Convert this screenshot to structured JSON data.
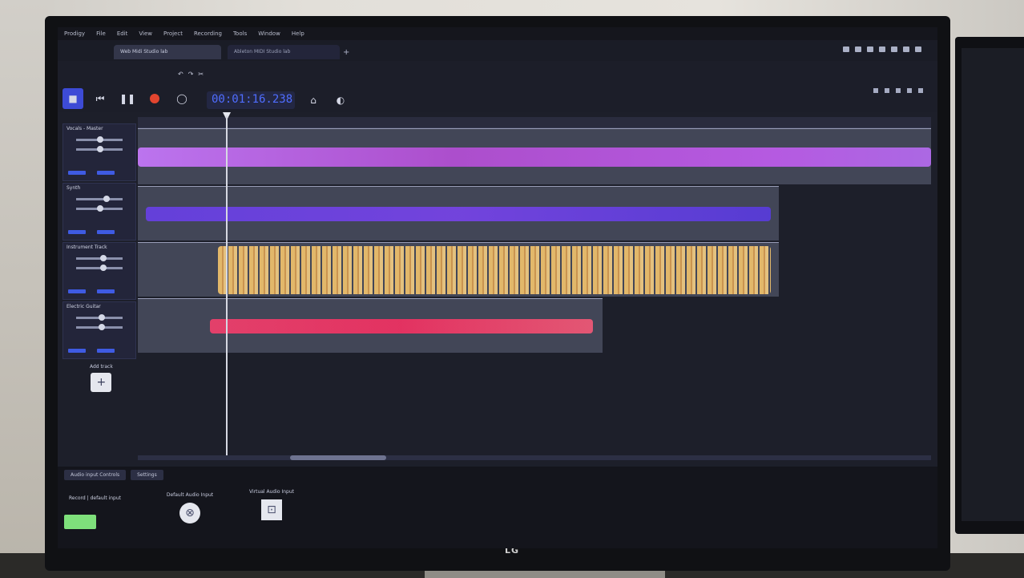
{
  "app": {
    "menu": [
      "Prodigy",
      "File",
      "Edit",
      "View",
      "Project",
      "Recording",
      "Tools",
      "Window",
      "Help"
    ]
  },
  "tabs": [
    {
      "label": "Web Midi Studio lab"
    },
    {
      "label": "Ableton MIDI Studio lab"
    }
  ],
  "transport": {
    "time": "00:01:16.238",
    "buttons": [
      "stop-icon",
      "skip-back-icon",
      "pause-icon",
      "record-icon",
      "loop-icon"
    ],
    "tools": [
      "metronome-icon",
      "settings-icon"
    ],
    "accent": "#3d4bd6",
    "record_color": "#e2452f"
  },
  "tracks": [
    {
      "name": "Vocals - Master",
      "color": "#b86cf2"
    },
    {
      "name": "Synth",
      "color": "#6f4cf0"
    },
    {
      "name": "Instrument Track",
      "color": "#f3c46a"
    },
    {
      "name": "Electric Guitar",
      "color": "#ff3f6e"
    }
  ],
  "add_track": {
    "label": "Add track"
  },
  "bottom": {
    "tabs": [
      "Audio input Controls",
      "Settings"
    ],
    "record_device": "Record | default input",
    "devices": [
      {
        "label": "Default Audio Input",
        "icon": "microphone-icon"
      },
      {
        "label": "Virtual Audio Input",
        "icon": "add-device-icon"
      }
    ],
    "meter_color": "#7ee07b"
  },
  "brand": {
    "logo": "LG"
  }
}
